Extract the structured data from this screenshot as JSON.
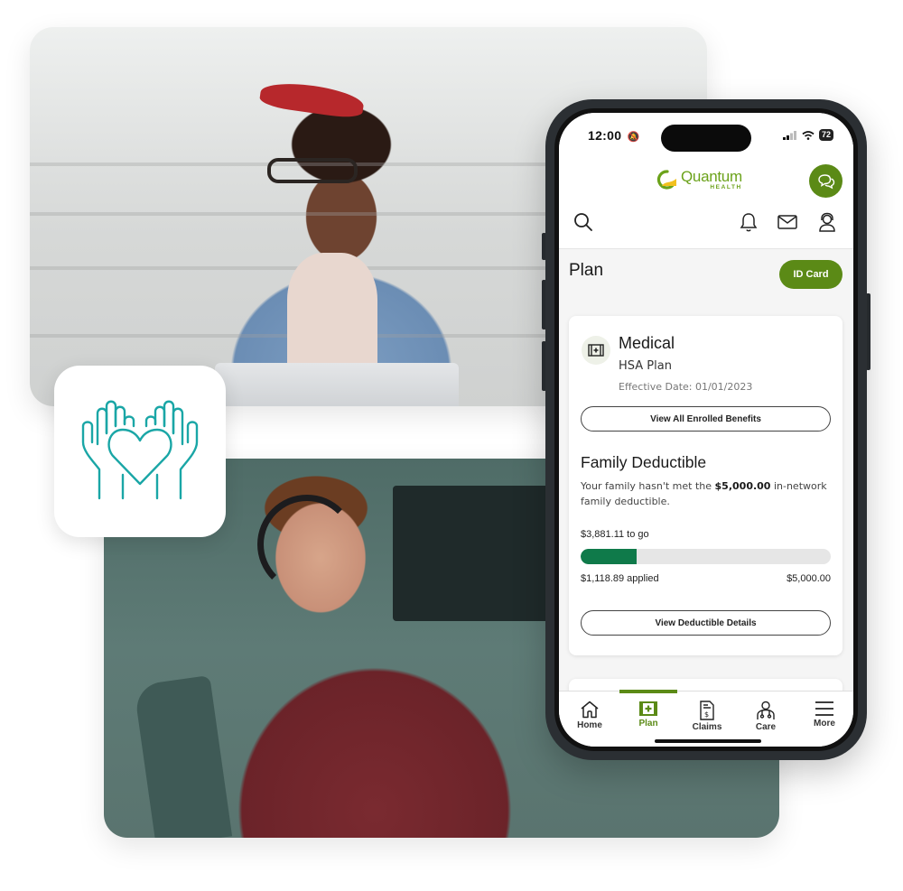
{
  "photos": {
    "top": {
      "label": "Woman with glasses working on laptop on stairs"
    },
    "bottom": {
      "label": "Man wearing headset at office desk"
    }
  },
  "care_tile": {
    "icon": "heart-in-hands-icon",
    "color": "#1aa6a6"
  },
  "phone": {
    "status_bar": {
      "time": "12:00",
      "silent_icon": "bell-slash",
      "battery": "72"
    },
    "header": {
      "logo_name": "Quantum",
      "logo_sub": "HEALTH",
      "icons": [
        "search-icon",
        "bell-icon",
        "mail-icon",
        "support-agent-icon"
      ],
      "chat_icon": "chat-bubbles-icon"
    },
    "page": {
      "title": "Plan",
      "id_card_label": "ID Card"
    },
    "medical_card": {
      "title": "Medical",
      "plan": "HSA Plan",
      "effective_date": "Effective Date: 01/01/2023",
      "benefits_button": "View All Enrolled Benefits"
    },
    "deductible": {
      "title": "Family Deductible",
      "desc_prefix": "Your family hasn't met the ",
      "desc_amount": "$5,000.00",
      "desc_suffix": " in-network family deductible.",
      "remaining": "$3,881.11 to go",
      "applied": "$1,118.89 applied",
      "total": "$5,000.00",
      "progress_fraction": 0.2238,
      "details_button": "View Deductible Details"
    },
    "tabbar": {
      "items": [
        {
          "label": "Home",
          "icon": "home-icon",
          "active": false
        },
        {
          "label": "Plan",
          "icon": "medical-plan-icon",
          "active": true
        },
        {
          "label": "Claims",
          "icon": "claim-document-icon",
          "active": false
        },
        {
          "label": "Care",
          "icon": "care-team-icon",
          "active": false
        },
        {
          "label": "More",
          "icon": "hamburger-menu-icon",
          "active": false
        }
      ]
    }
  },
  "colors": {
    "brand_green": "#5b8a16",
    "logo_green": "#6ba21a",
    "progress_green": "#0f7a4a",
    "teal": "#1aa6a6"
  }
}
